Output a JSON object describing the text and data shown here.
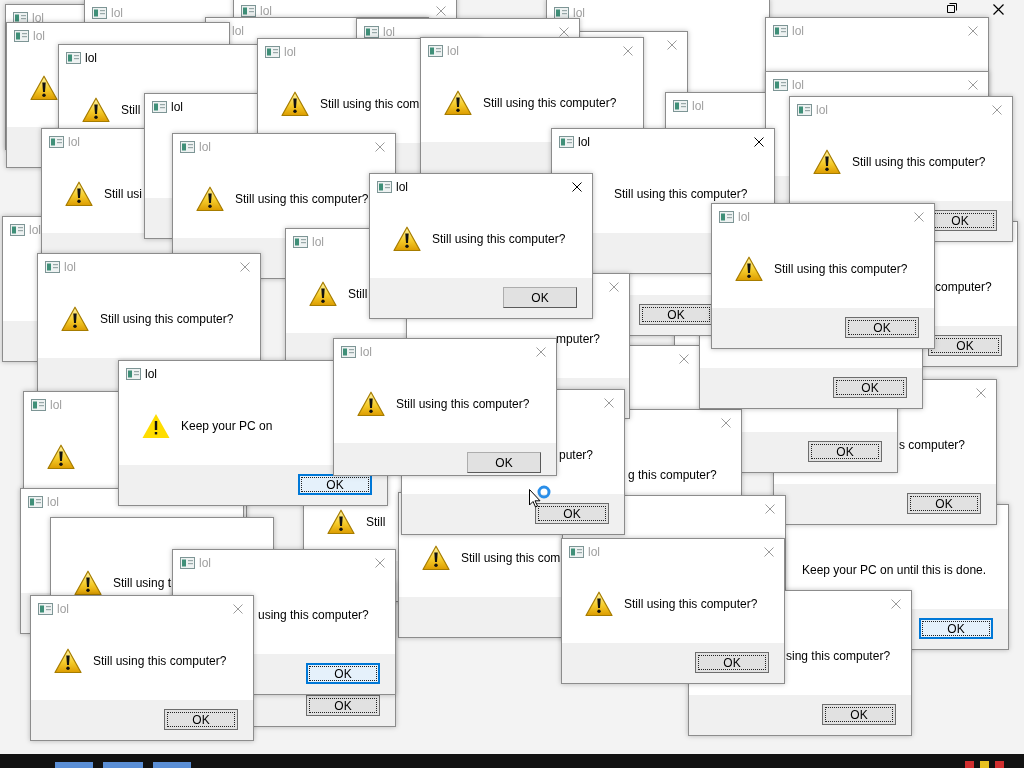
{
  "windows": [
    {
      "kind": "prompt",
      "title": "lol",
      "active": false
    },
    {
      "kind": "prompt",
      "title": "lol",
      "active": false
    },
    {
      "kind": "prompt",
      "title": "lol",
      "active": false
    },
    {
      "kind": "prompt",
      "title": "lol",
      "active": false
    },
    {
      "kind": "prompt",
      "title": "lol",
      "active": false
    },
    {
      "kind": "prompt",
      "title": "lol",
      "active": false
    },
    {
      "kind": "prompt",
      "title": "lol",
      "active": false
    },
    {
      "kind": "prompt",
      "title": "lol",
      "active": false
    },
    {
      "kind": "prompt",
      "title": "lol",
      "active": true,
      "message": "Still"
    },
    {
      "kind": "prompt",
      "title": "lol",
      "active": false,
      "message": "Still using this com"
    },
    {
      "kind": "prompt",
      "title": "lol",
      "active": false,
      "message": "Still using this computer?"
    },
    {
      "kind": "prompt",
      "active": false
    },
    {
      "kind": "prompt",
      "title": "lol",
      "active": false
    },
    {
      "kind": "prompt",
      "title": "lol",
      "active": true
    },
    {
      "kind": "prompt",
      "title": "lol",
      "active": false
    },
    {
      "kind": "prompt",
      "title": "lol",
      "active": false,
      "message": "Still usi"
    },
    {
      "kind": "prompt",
      "title": "lol",
      "active": false,
      "message": "Still using this computer?"
    },
    {
      "kind": "prompt",
      "title": "lol",
      "active": true,
      "message": "Still using this computer?",
      "button": {
        "label": "OK",
        "focused": false,
        "highlighted": false
      }
    },
    {
      "kind": "prompt",
      "title": "lol",
      "active": true,
      "message": "Still using this computer?"
    },
    {
      "kind": "prompt",
      "title": "lol",
      "active": false,
      "message": "Still using this computer?",
      "button": {
        "label": "OK",
        "focused": true,
        "highlighted": false
      }
    },
    {
      "kind": "prompt",
      "button": {
        "label": "OK",
        "focused": true,
        "highlighted": false
      }
    },
    {
      "kind": "prompt",
      "title": "lol",
      "active": false
    },
    {
      "kind": "prompt",
      "title": "lol",
      "active": false,
      "message": "Still"
    },
    {
      "kind": "prompt",
      "title": "lol",
      "active": false,
      "message": "Still using this computer?",
      "button": {
        "label": "OK",
        "focused": true,
        "highlighted": false
      }
    },
    {
      "kind": "prompt",
      "message": "computer?",
      "button": {
        "label": "OK",
        "focused": true,
        "highlighted": false
      }
    },
    {
      "kind": "prompt",
      "title": "lol",
      "active": false,
      "message": "Still using this computer?"
    },
    {
      "kind": "prompt",
      "active": false,
      "message": "mputer?"
    },
    {
      "kind": "prompt",
      "button": {
        "label": "OK",
        "focused": true,
        "highlighted": false
      }
    },
    {
      "kind": "notice",
      "title": "lol",
      "active": true,
      "message": "Keep your PC on",
      "button": {
        "label": "OK",
        "focused": true,
        "highlighted": true
      }
    },
    {
      "kind": "prompt",
      "title": "lol",
      "active": false,
      "message": "Still using this computer?",
      "button": {
        "label": "OK",
        "focused": false,
        "highlighted": false
      }
    },
    {
      "kind": "prompt",
      "active": false
    },
    {
      "kind": "prompt",
      "button": {
        "label": "OK",
        "focused": true,
        "highlighted": false
      }
    },
    {
      "kind": "prompt",
      "title": "lol",
      "active": false
    },
    {
      "kind": "prompt",
      "active": false,
      "message": "puter?",
      "button": {
        "label": "OK",
        "focused": true,
        "highlighted": false
      }
    },
    {
      "kind": "prompt",
      "active": false,
      "message": "g this computer?"
    },
    {
      "kind": "prompt",
      "active": false,
      "message": "s computer?",
      "button": {
        "label": "OK",
        "focused": true,
        "highlighted": false
      }
    },
    {
      "kind": "prompt",
      "message": "Still"
    },
    {
      "kind": "prompt",
      "title": "lol",
      "active": false
    },
    {
      "kind": "prompt",
      "message": "Still using t"
    },
    {
      "kind": "prompt",
      "message": "Still using this com"
    },
    {
      "kind": "prompt",
      "active": false
    },
    {
      "kind": "notice",
      "message": "Keep your PC on until this is done.",
      "button": {
        "label": "OK",
        "focused": true,
        "highlighted": true
      }
    },
    {
      "kind": "prompt",
      "title": "lol",
      "active": false,
      "message": "using this computer?",
      "button": {
        "label": "OK",
        "focused": true,
        "highlighted": true
      }
    },
    {
      "kind": "prompt",
      "title": "lol",
      "active": false,
      "message": "Still using this computer?",
      "button": {
        "label": "OK",
        "focused": true,
        "highlighted": false
      }
    },
    {
      "kind": "prompt",
      "title": "lol",
      "active": false,
      "message": "Still using this computer?",
      "button": {
        "label": "OK",
        "focused": true,
        "highlighted": false
      }
    },
    {
      "kind": "prompt",
      "button": {
        "label": "OK",
        "focused": true,
        "highlighted": false
      }
    },
    {
      "kind": "prompt",
      "message": "sing this computer?",
      "button": {
        "label": "OK",
        "focused": true,
        "highlighted": false
      }
    }
  ]
}
